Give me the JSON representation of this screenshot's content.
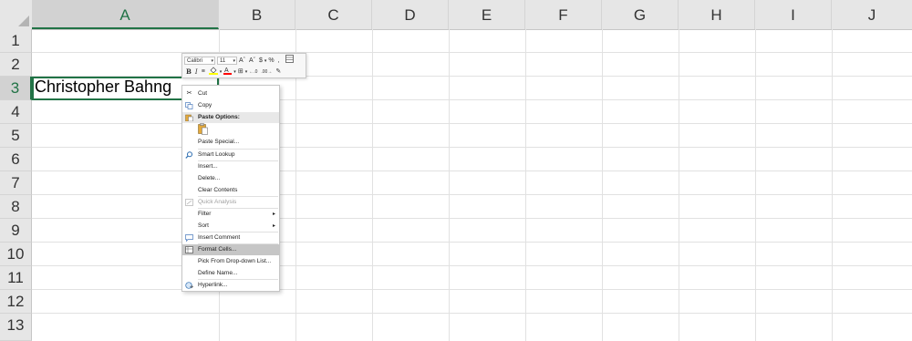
{
  "columns": [
    "A",
    "B",
    "C",
    "D",
    "E",
    "F",
    "G",
    "H",
    "I",
    "J"
  ],
  "rows": [
    "1",
    "2",
    "3",
    "4",
    "5",
    "6",
    "7",
    "8",
    "9",
    "10",
    "11",
    "12",
    "13"
  ],
  "cell_a3": "Christopher Bahng",
  "mini_toolbar": {
    "font_name": "Calibri",
    "font_size": "11",
    "grow_font": "Aˆ",
    "shrink_font": "Aˇ",
    "currency": "$",
    "percent": "%",
    "comma": ",",
    "bold": "B",
    "italic": "I",
    "align": "≡",
    "fill_color": "#ffff00",
    "font_color": "#ff0000",
    "borders": "⊞",
    "increase_decimal": "←.0",
    "decrease_decimal": ".00→",
    "format_painter": "✎"
  },
  "context_menu": {
    "cut": "Cut",
    "copy": "Copy",
    "paste_options": "Paste Options:",
    "paste_special": "Paste Special...",
    "smart_lookup": "Smart Lookup",
    "insert": "Insert...",
    "delete": "Delete...",
    "clear_contents": "Clear Contents",
    "quick_analysis": "Quick Analysis",
    "filter": "Filter",
    "sort": "Sort",
    "insert_comment": "Insert Comment",
    "format_cells": "Format Cells...",
    "pick_from_dropdown": "Pick From Drop-down List...",
    "define_name": "Define Name...",
    "hyperlink": "Hyperlink..."
  },
  "colors": {
    "excel_green": "#217346",
    "header_bg": "#e6e6e6",
    "menu_highlight": "#c6c6c6"
  }
}
